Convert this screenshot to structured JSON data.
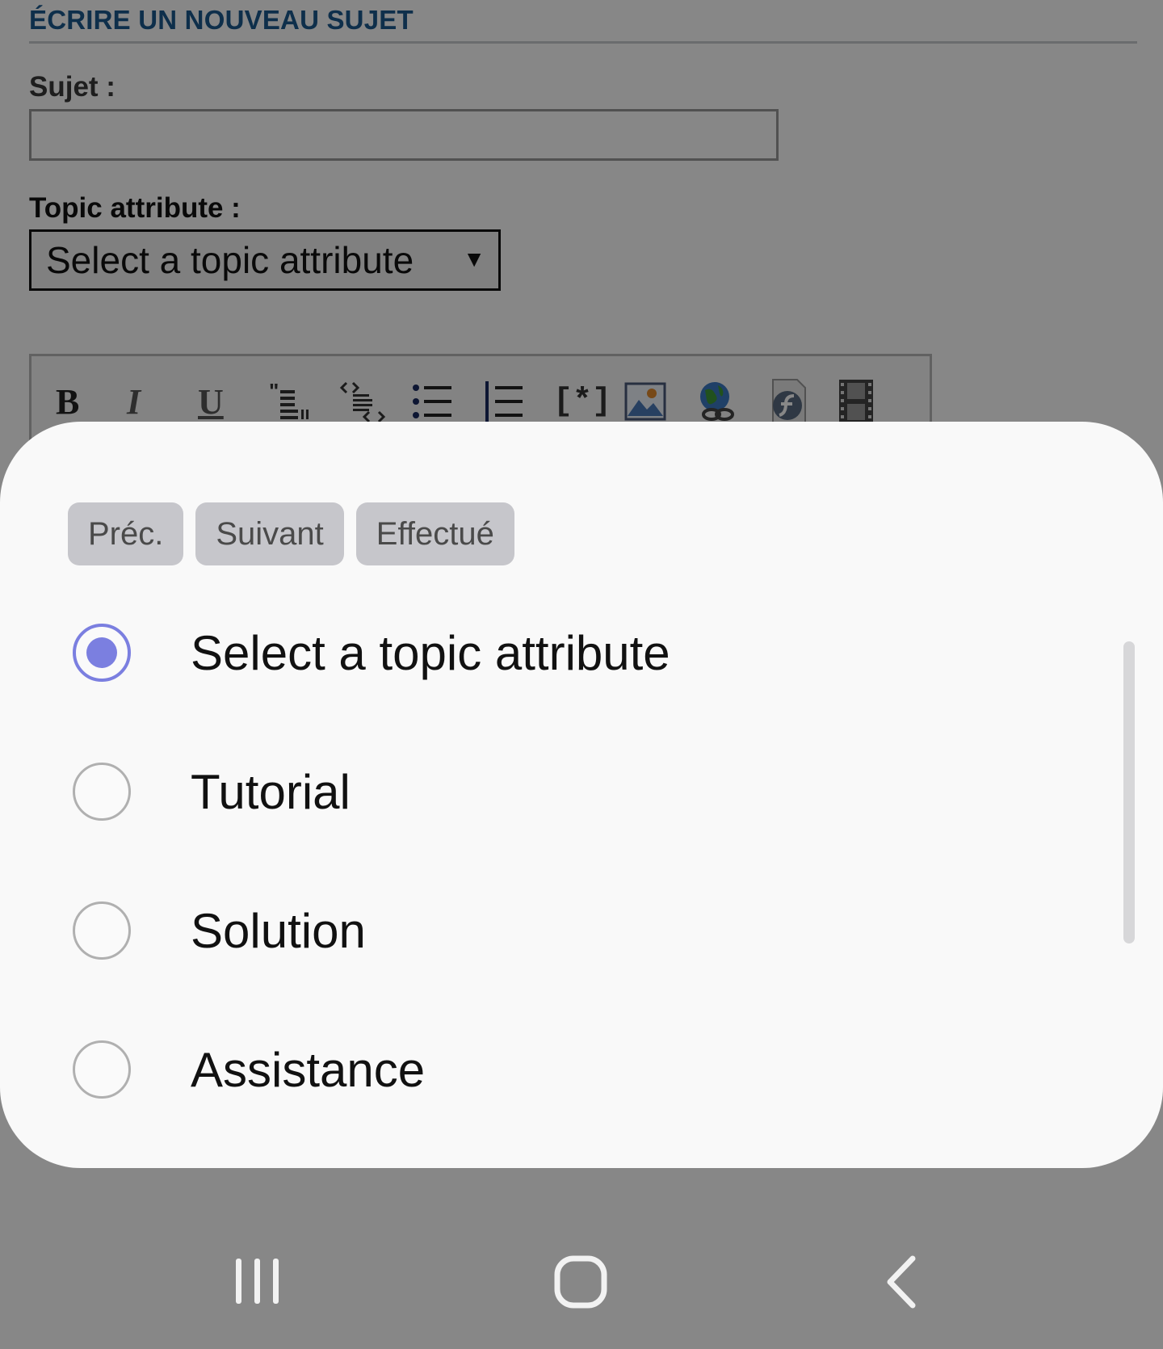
{
  "form": {
    "section_title": "ÉCRIRE UN NOUVEAU SUJET",
    "subject_label": "Sujet :",
    "subject_value": "",
    "topic_label": "Topic attribute :",
    "topic_selected": "Select a topic attribute"
  },
  "toolbar": {
    "buttons": [
      {
        "icon": "bold-icon",
        "glyph": "B"
      },
      {
        "icon": "italic-icon",
        "glyph": "I"
      },
      {
        "icon": "underline-icon",
        "glyph": "U"
      },
      {
        "icon": "quote-icon"
      },
      {
        "icon": "code-icon"
      },
      {
        "icon": "bullet-list-icon"
      },
      {
        "icon": "numbered-list-icon"
      },
      {
        "icon": "list-item-icon",
        "glyph": "[*]"
      },
      {
        "icon": "image-icon"
      },
      {
        "icon": "link-icon"
      },
      {
        "icon": "flash-icon"
      },
      {
        "icon": "video-icon"
      }
    ]
  },
  "picker": {
    "nav": {
      "prev_label": "Préc.",
      "next_label": "Suivant",
      "done_label": "Effectué"
    },
    "options": [
      {
        "label": "Select a topic attribute",
        "checked": true
      },
      {
        "label": "Tutorial",
        "checked": false
      },
      {
        "label": "Solution",
        "checked": false
      },
      {
        "label": "Assistance",
        "checked": false
      }
    ],
    "accent_color": "#7b7fe0"
  },
  "system_nav": {
    "recents_icon": "recents-icon",
    "home_icon": "home-icon",
    "back_icon": "back-icon"
  }
}
